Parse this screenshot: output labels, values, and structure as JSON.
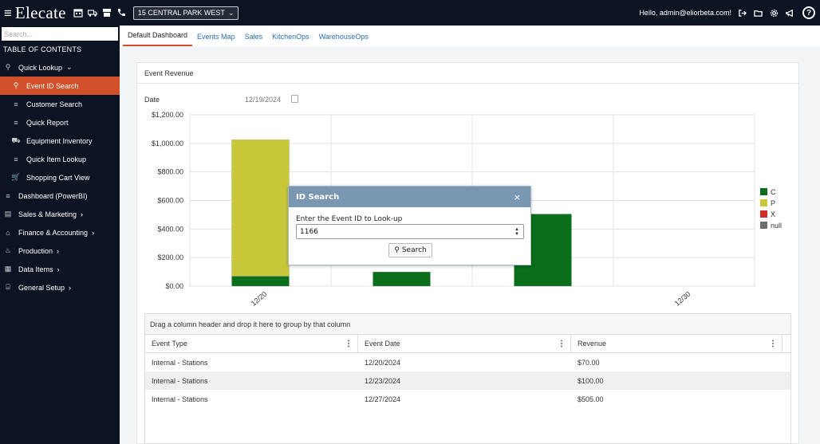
{
  "header": {
    "brand": "Elecate",
    "location": "15 CENTRAL PARK WEST",
    "greeting": "Hello, admin@eliorbeta.com!"
  },
  "sidebar": {
    "search_placeholder": "Search...",
    "toc_title": "TABLE OF CONTENTS",
    "items": [
      {
        "label": "Quick Lookup",
        "icon": "search-icon",
        "sub": false,
        "active": false,
        "chevron": "down"
      },
      {
        "label": "Event ID Search",
        "icon": "search-icon",
        "sub": true,
        "active": true
      },
      {
        "label": "Customer Search",
        "icon": "list-icon",
        "sub": true,
        "active": false
      },
      {
        "label": "Quick Report",
        "icon": "list-icon",
        "sub": true,
        "active": false
      },
      {
        "label": "Equipment Inventory",
        "icon": "forklift-icon",
        "sub": true,
        "active": false
      },
      {
        "label": "Quick Item Lookup",
        "icon": "list-icon",
        "sub": true,
        "active": false
      },
      {
        "label": "Shopping Cart View",
        "icon": "cart-icon",
        "sub": true,
        "active": false
      },
      {
        "label": "Dashboard (PowerBI)",
        "icon": "list-icon",
        "sub": false,
        "active": false
      },
      {
        "label": "Sales & Marketing",
        "icon": "register-icon",
        "sub": false,
        "active": false,
        "chevron": "right"
      },
      {
        "label": "Finance & Accounting",
        "icon": "bank-icon",
        "sub": false,
        "active": false,
        "chevron": "right"
      },
      {
        "label": "Production",
        "icon": "chef-icon",
        "sub": false,
        "active": false,
        "chevron": "right"
      },
      {
        "label": "Data Items",
        "icon": "data-icon",
        "sub": false,
        "active": false,
        "chevron": "right"
      },
      {
        "label": "General Setup",
        "icon": "setup-icon",
        "sub": false,
        "active": false,
        "chevron": "right"
      }
    ]
  },
  "tabs": [
    {
      "label": "Default Dashboard",
      "active": true
    },
    {
      "label": "Events Map",
      "active": false
    },
    {
      "label": "Sales",
      "active": false
    },
    {
      "label": "KitchenOps",
      "active": false
    },
    {
      "label": "WarehouseOps",
      "active": false
    }
  ],
  "panel": {
    "title": "Event Revenue",
    "date_label": "Date",
    "date_value": "12/19/2024"
  },
  "chart_data": {
    "type": "bar",
    "stacked": true,
    "categories": [
      "12/20",
      "12/23",
      "12/27",
      "12/30"
    ],
    "tick_labels_shown": [
      "12/20",
      "12/30"
    ],
    "series": [
      {
        "name": "C",
        "color": "#0a6e1a",
        "values": [
          70,
          100,
          505,
          0
        ]
      },
      {
        "name": "P",
        "color": "#c9c83a",
        "values": [
          955,
          0,
          0,
          0
        ]
      },
      {
        "name": "X",
        "color": "#d32a2a",
        "values": [
          0,
          0,
          0,
          0
        ]
      },
      {
        "name": "null",
        "color": "#6f6f6f",
        "values": [
          0,
          0,
          0,
          0
        ]
      }
    ],
    "yticks": [
      "$0.00",
      "$200.00",
      "$400.00",
      "$600.00",
      "$800.00",
      "$1,000.00",
      "$1,200.00"
    ],
    "ylim": [
      0,
      1200
    ],
    "grid": true,
    "legend": "right"
  },
  "grid": {
    "group_hint": "Drag a column header and drop it here to group by that column",
    "columns": [
      "Event Type",
      "Event Date",
      "Revenue"
    ],
    "rows": [
      [
        "Internal - Stations",
        "12/20/2024",
        "$70.00"
      ],
      [
        "Internal - Stations",
        "12/23/2024",
        "$100.00"
      ],
      [
        "Internal - Stations",
        "12/27/2024",
        "$505.00"
      ]
    ]
  },
  "modal": {
    "title": "ID Search",
    "close": "×",
    "label": "Enter the Event ID to Look-up",
    "value": "1166",
    "search_label": "Search"
  }
}
